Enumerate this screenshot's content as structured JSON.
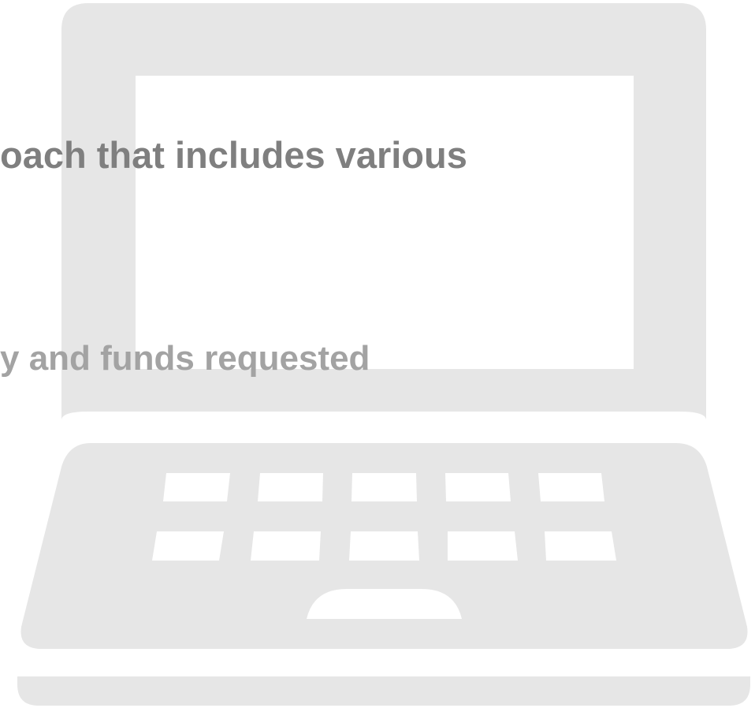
{
  "icon": "laptop-icon",
  "colors": {
    "background": "#ffffff",
    "laptop_body": "#e6e6e6",
    "laptop_screen": "#ffffff",
    "text_primary": "#7f7f7f",
    "text_secondary": "#a3a3a3"
  },
  "text": {
    "line_1": "oach that includes various",
    "line_2": "y and funds requested"
  }
}
